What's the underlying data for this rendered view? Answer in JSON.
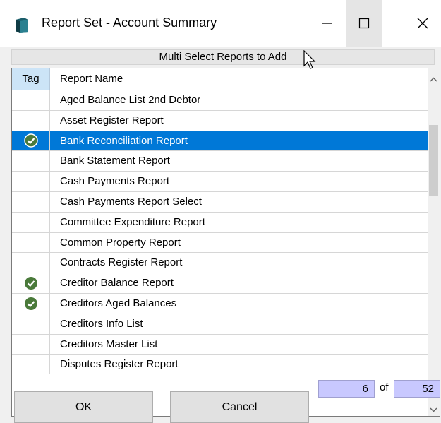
{
  "window": {
    "title": "Report Set - Account Summary",
    "controls": {
      "minimize": "minimize",
      "maximize": "maximize",
      "close": "close"
    }
  },
  "banner": {
    "text": "Multi Select Reports to Add"
  },
  "grid": {
    "columns": {
      "tag": "Tag",
      "name": "Report Name"
    },
    "rows": [
      {
        "name": "Aged Balance List 2nd Debtor",
        "tagged": false,
        "selected": false
      },
      {
        "name": "Asset Register Report",
        "tagged": false,
        "selected": false
      },
      {
        "name": "Bank Reconciliation Report",
        "tagged": true,
        "selected": true
      },
      {
        "name": "Bank Statement Report",
        "tagged": false,
        "selected": false
      },
      {
        "name": "Cash Payments Report",
        "tagged": false,
        "selected": false
      },
      {
        "name": "Cash Payments Report Select",
        "tagged": false,
        "selected": false
      },
      {
        "name": "Committee Expenditure Report",
        "tagged": false,
        "selected": false
      },
      {
        "name": "Common Property Report",
        "tagged": false,
        "selected": false
      },
      {
        "name": "Contracts Register Report",
        "tagged": false,
        "selected": false
      },
      {
        "name": "Creditor Balance Report",
        "tagged": true,
        "selected": false
      },
      {
        "name": "Creditors Aged Balances",
        "tagged": true,
        "selected": false
      },
      {
        "name": "Creditors Info List",
        "tagged": false,
        "selected": false
      },
      {
        "name": "Creditors Master List",
        "tagged": false,
        "selected": false
      },
      {
        "name": "Disputes Register Report",
        "tagged": false,
        "selected": false
      }
    ]
  },
  "counter": {
    "current": "6",
    "of": "of",
    "total": "52"
  },
  "buttons": {
    "ok": "OK",
    "cancel": "Cancel"
  },
  "colors": {
    "selection": "#0078d7",
    "tag_header": "#cce4f7",
    "counter_bg": "#c8c8ff",
    "check": "#4a7a3a"
  }
}
